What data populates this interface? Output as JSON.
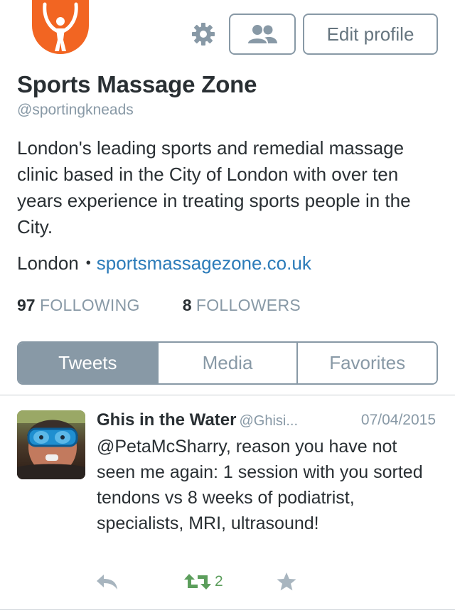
{
  "profile": {
    "display_name": "Sports Massage Zone",
    "handle": "@sportingkneads",
    "bio": "London's leading sports and remedial massage clinic based in the City of London with over ten years experience in treating sports people in the City.",
    "location": "London",
    "website": "sportsmassagezone.co.uk",
    "following_count": "97",
    "following_label": "FOLLOWING",
    "followers_count": "8",
    "followers_label": "FOLLOWERS",
    "logo_color": "#f26522"
  },
  "toolbar": {
    "settings_icon": "gear-icon",
    "people_icon": "people-icon",
    "edit_profile_label": "Edit profile"
  },
  "tabs": [
    {
      "label": "Tweets",
      "active": true
    },
    {
      "label": "Media",
      "active": false
    },
    {
      "label": "Favorites",
      "active": false
    }
  ],
  "tweet": {
    "author": "Ghis in the Water",
    "handle": "@Ghisi...",
    "date": "07/04/2015",
    "text": "@PetaMcSharry, reason you have not seen me again: 1 session with you sorted tendons vs 8 weeks of podiatrist, specialists, MRI, ultrasound!",
    "retweet_count": "2",
    "retweet_color": "#5c9e5c"
  },
  "colors": {
    "accent_gray": "#8899a6",
    "link": "#2b7bb9",
    "text": "#292f33"
  }
}
